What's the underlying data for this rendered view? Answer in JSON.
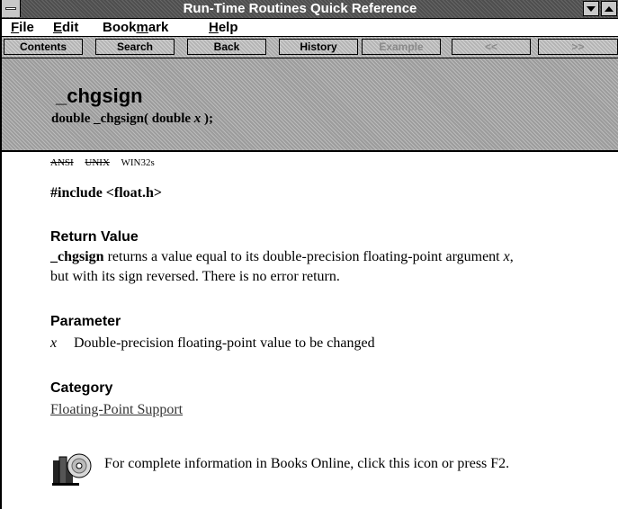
{
  "window": {
    "title": "Run-Time Routines Quick Reference"
  },
  "menu": [
    {
      "pre": "",
      "u": "F",
      "post": "ile"
    },
    {
      "pre": "",
      "u": "E",
      "post": "dit"
    },
    {
      "pre": "Book",
      "u": "m",
      "post": "ark"
    },
    {
      "pre": "",
      "u": "H",
      "post": "elp"
    }
  ],
  "toolbar": {
    "contents": "Contents",
    "search": "Search",
    "back": "Back",
    "history": "History",
    "example": "Example",
    "prev": "<<",
    "next": ">>"
  },
  "topic": {
    "title": "_chgsign",
    "syntax_pre": "double _chgsign( double ",
    "syntax_arg": "x",
    "syntax_post": " );"
  },
  "compat": {
    "ansi": "ANSI",
    "unix": "UNIX",
    "win32s": "WIN32s"
  },
  "include": "#include <float.h>",
  "return_value": {
    "heading": "Return Value",
    "name": "_chgsign",
    "text1": " returns a value equal to its double-precision floating-point argument ",
    "arg": "x",
    "text2": ",",
    "line2": "but with its sign reversed. There is no error return."
  },
  "parameter": {
    "heading": "Parameter",
    "name": "x",
    "desc": "Double-precision floating-point value to be changed"
  },
  "category": {
    "heading": "Category",
    "link": "Floating-Point Support"
  },
  "books_online": {
    "icon": "books-online-icon",
    "text": "For complete information in Books Online, click this icon or press F2."
  }
}
